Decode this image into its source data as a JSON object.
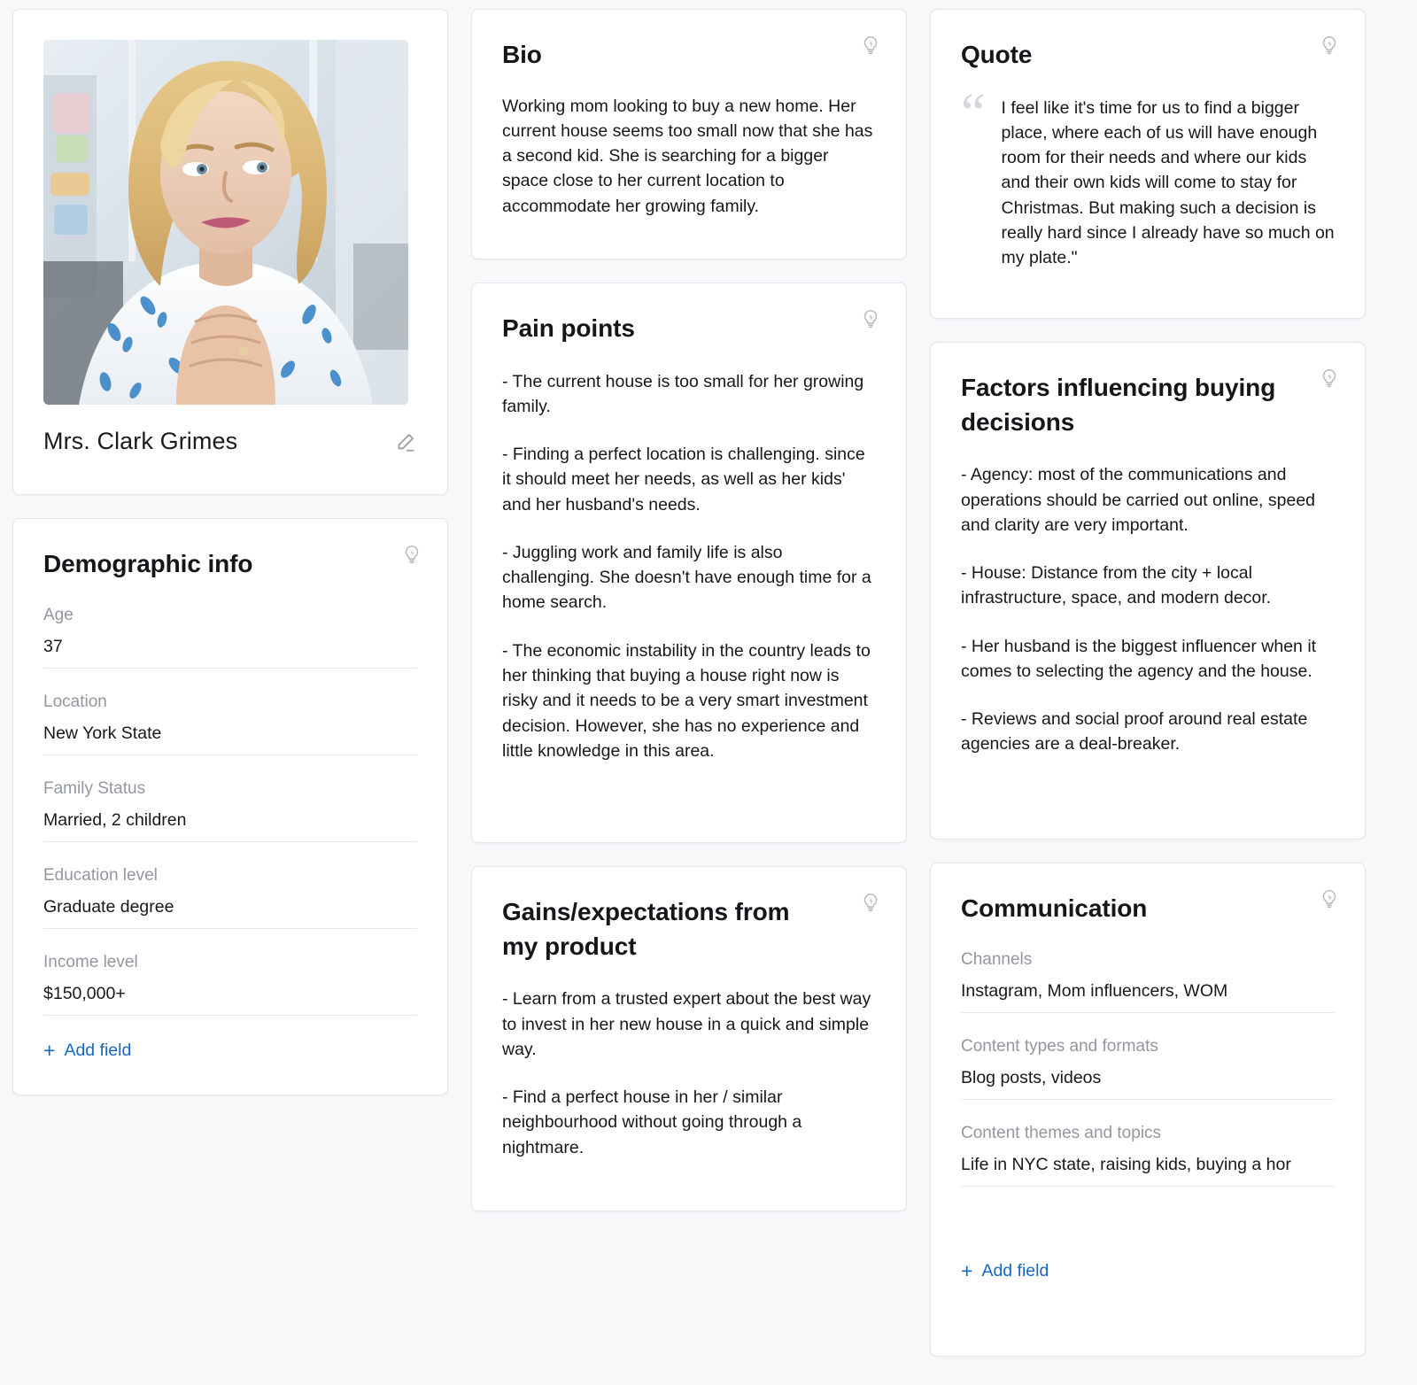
{
  "profile": {
    "name": "Mrs. Clark Grimes",
    "edit_icon": "pencil-icon",
    "avatar_alt": "Blonde woman resting chin on hands, wearing white blouse with blue floral print"
  },
  "icons": {
    "insight": "lightbulb-bolt-icon",
    "add": "plus-icon",
    "quote": "quote-mark-icon"
  },
  "colors": {
    "page_background": "#f7f8fa",
    "card_background": "#ffffff",
    "card_border": "#e4e6ea",
    "label_text": "#9297a0",
    "body_text": "#17181c",
    "link_accent": "#1667c8",
    "icon_muted": "#b4b8be"
  },
  "demographic": {
    "title": "Demographic info",
    "fields": [
      {
        "label": "Age",
        "value": "37"
      },
      {
        "label": "Location",
        "value": "New York State"
      },
      {
        "label": "Family Status",
        "value": "Married, 2 children"
      },
      {
        "label": "Education level",
        "value": "Graduate degree"
      },
      {
        "label": "Income level",
        "value": "$150,000+"
      }
    ],
    "add_field_label": "Add field"
  },
  "bio": {
    "title": "Bio",
    "text": "Working mom looking to buy a new home. Her current house seems too small now that she has a second kid. She is searching for a bigger space close to her current location to accommodate her growing family."
  },
  "pain_points": {
    "title": "Pain points",
    "items": [
      "- The current house is too small for her growing family.",
      "- Finding a perfect location is challenging. since it should meet her needs, as well as her kids' and her husband's needs.",
      "- Juggling work and family life is also challenging. She doesn't have enough time for a home search.",
      "- The economic instability in the country leads to her thinking that buying a house right now is risky and it needs to be a very smart investment decision. However, she has no experience and little knowledge in this area."
    ]
  },
  "gains": {
    "title": "Gains/expectations from my product",
    "items": [
      "- Learn from a trusted expert about the best way to invest in her new house in a quick and simple way.",
      "- Find a perfect house in her / similar neighbourhood without going through a nightmare."
    ]
  },
  "quote": {
    "title": "Quote",
    "text": "I feel like it's time for us to find a bigger place, where each of us will have enough room for their needs and where our kids and their own kids will come to stay for Christmas. But making such a decision is really hard since I already have so much on my plate.\""
  },
  "factors": {
    "title": "Factors influencing buying decisions",
    "items": [
      "- Agency: most of the communications and operations should be carried out online, speed and clarity are very important.",
      "- House: Distance from the city + local infrastructure, space, and modern decor.",
      "- Her husband is the biggest influencer when it comes to selecting the agency and the house.",
      "- Reviews and social proof around real estate agencies are a deal-breaker."
    ]
  },
  "communication": {
    "title": "Communication",
    "fields": [
      {
        "label": "Channels",
        "value": "Instagram, Mom influencers, WOM"
      },
      {
        "label": "Content types and formats",
        "value": "Blog posts, videos"
      },
      {
        "label": "Content themes and topics",
        "value": "Life in NYC state, raising kids, buying a hor"
      }
    ],
    "add_field_label": "Add field"
  }
}
